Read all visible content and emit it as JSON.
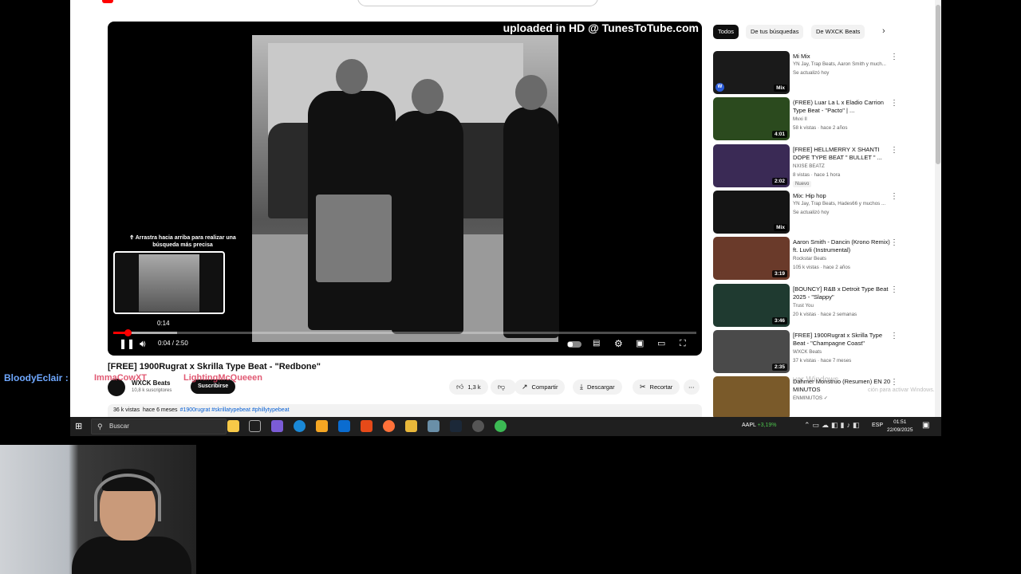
{
  "player": {
    "watermark": "uploaded in HD @ TunesToTube.com",
    "hint": "⇮ Arrastra hacia arriba para realizar una búsqueda más precisa",
    "preview_time": "0:14",
    "current_time": "0:04 / 2:50",
    "progress_fraction": 0.024,
    "buffer_fraction": 0.11
  },
  "video": {
    "title": "[FREE] 1900Rugrat x Skrilla Type Beat - \"Redbone\"",
    "channel": "WXCK Beats",
    "subscribers": "10,8 k suscriptores",
    "subscribe_label": "Suscribirse",
    "likes": "1,3 k",
    "share_label": "Compartir",
    "download_label": "Descargar",
    "clip_label": "Recortar",
    "views": "36 k vistas",
    "age": "hace 6 meses",
    "tags": "#1900rugrat #skrillatypebeat #phillytypebeat"
  },
  "chips": [
    "Todos",
    "De tus búsquedas",
    "De WXCK Beats"
  ],
  "recommendations": [
    {
      "title": "Mi Mix",
      "channel": "YN Jay, Trap Beats, Aaron Smith y much...",
      "meta": "Se actualizó hoy",
      "badge": "Mix",
      "thumb": "#1a1a1a"
    },
    {
      "title": "(FREE) Luar La L x Eladio Carrion Type Beat - \"Pacto\" | ...",
      "channel": "Mvxi II",
      "meta": "58 k vistas · hace 2 años",
      "badge": "4:01",
      "thumb": "#2b4a1e"
    },
    {
      "title": "[FREE] HELLMERRY X SHANTI DOPE TYPE BEAT \" BULLET \" ...",
      "channel": "NXISE BEATZ",
      "meta": "8 vistas · hace 1 hora",
      "badge": "2:02",
      "thumb": "#3a2a55",
      "new": "Nuevo"
    },
    {
      "title": "Mix: Hip hop",
      "channel": "YN Jay, Trap Beats, Hades66 y muchos ...",
      "meta": "Se actualizó hoy",
      "badge": "Mix",
      "thumb": "#141414"
    },
    {
      "title": "Aaron Smith - Dancin (Krono Remix) ft. Luvli (Instrumental)",
      "channel": "Rockstar Beats",
      "meta": "105 k vistas · hace 2 años",
      "badge": "3:19",
      "thumb": "#6a3a2a"
    },
    {
      "title": "[BOUNCY] R&B x Detroit Type Beat 2025 - \"Slappy\"",
      "channel": "Trust You",
      "meta": "20 k vistas · hace 2 semanas",
      "badge": "3:46",
      "thumb": "#1f3a30"
    },
    {
      "title": "[FREE] 1900Rugrat x Skrilla Type Beat - \"Champagne Coast\"",
      "channel": "WXCK Beats",
      "meta": "37 k vistas · hace 7 meses",
      "badge": "2:35",
      "thumb": "#4a4a4a"
    },
    {
      "title": "Dahmer Monstruo (Resumen) EN 20 MINUTOS",
      "channel": "ENMINUTOS ✓",
      "meta": "",
      "badge": "",
      "thumb": "#7a5a2a"
    }
  ],
  "overlay": {
    "activate": "var Windows",
    "activate_sub": "ción para activar Windows."
  },
  "taskbar": {
    "search_placeholder": "Buscar",
    "stock_symbol": "AAPL",
    "stock_change": "+3,19%",
    "lang": "ESP",
    "time": "01:51",
    "date": "22/09/2025"
  },
  "chat": {
    "user1": "BloodyEclair :",
    "user2": "ImmaCowXT",
    "user3": "LightingMcQueeen"
  }
}
